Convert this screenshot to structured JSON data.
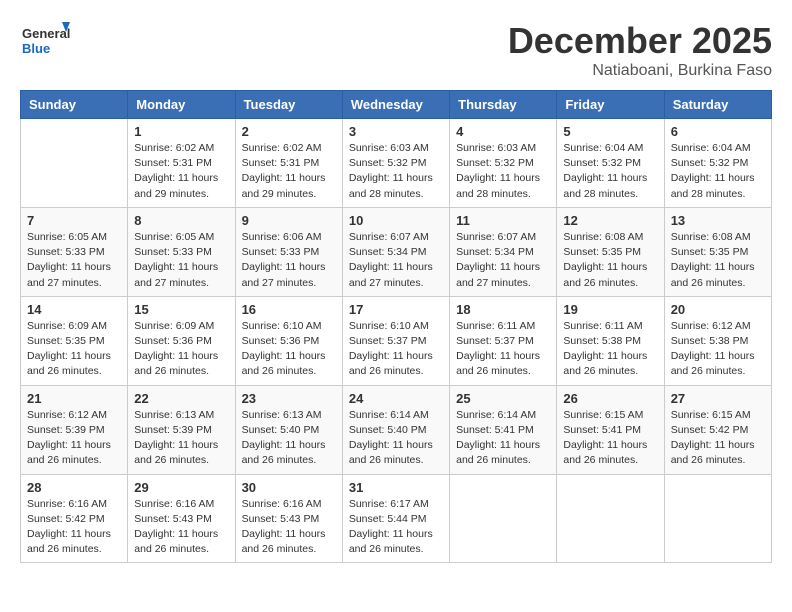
{
  "header": {
    "logo_general": "General",
    "logo_blue": "Blue",
    "month": "December 2025",
    "location": "Natiaboani, Burkina Faso"
  },
  "days_of_week": [
    "Sunday",
    "Monday",
    "Tuesday",
    "Wednesday",
    "Thursday",
    "Friday",
    "Saturday"
  ],
  "weeks": [
    [
      {
        "day": "",
        "sunrise": "",
        "sunset": "",
        "daylight": ""
      },
      {
        "day": "1",
        "sunrise": "Sunrise: 6:02 AM",
        "sunset": "Sunset: 5:31 PM",
        "daylight": "Daylight: 11 hours and 29 minutes."
      },
      {
        "day": "2",
        "sunrise": "Sunrise: 6:02 AM",
        "sunset": "Sunset: 5:31 PM",
        "daylight": "Daylight: 11 hours and 29 minutes."
      },
      {
        "day": "3",
        "sunrise": "Sunrise: 6:03 AM",
        "sunset": "Sunset: 5:32 PM",
        "daylight": "Daylight: 11 hours and 28 minutes."
      },
      {
        "day": "4",
        "sunrise": "Sunrise: 6:03 AM",
        "sunset": "Sunset: 5:32 PM",
        "daylight": "Daylight: 11 hours and 28 minutes."
      },
      {
        "day": "5",
        "sunrise": "Sunrise: 6:04 AM",
        "sunset": "Sunset: 5:32 PM",
        "daylight": "Daylight: 11 hours and 28 minutes."
      },
      {
        "day": "6",
        "sunrise": "Sunrise: 6:04 AM",
        "sunset": "Sunset: 5:32 PM",
        "daylight": "Daylight: 11 hours and 28 minutes."
      }
    ],
    [
      {
        "day": "7",
        "sunrise": "Sunrise: 6:05 AM",
        "sunset": "Sunset: 5:33 PM",
        "daylight": "Daylight: 11 hours and 27 minutes."
      },
      {
        "day": "8",
        "sunrise": "Sunrise: 6:05 AM",
        "sunset": "Sunset: 5:33 PM",
        "daylight": "Daylight: 11 hours and 27 minutes."
      },
      {
        "day": "9",
        "sunrise": "Sunrise: 6:06 AM",
        "sunset": "Sunset: 5:33 PM",
        "daylight": "Daylight: 11 hours and 27 minutes."
      },
      {
        "day": "10",
        "sunrise": "Sunrise: 6:07 AM",
        "sunset": "Sunset: 5:34 PM",
        "daylight": "Daylight: 11 hours and 27 minutes."
      },
      {
        "day": "11",
        "sunrise": "Sunrise: 6:07 AM",
        "sunset": "Sunset: 5:34 PM",
        "daylight": "Daylight: 11 hours and 27 minutes."
      },
      {
        "day": "12",
        "sunrise": "Sunrise: 6:08 AM",
        "sunset": "Sunset: 5:35 PM",
        "daylight": "Daylight: 11 hours and 26 minutes."
      },
      {
        "day": "13",
        "sunrise": "Sunrise: 6:08 AM",
        "sunset": "Sunset: 5:35 PM",
        "daylight": "Daylight: 11 hours and 26 minutes."
      }
    ],
    [
      {
        "day": "14",
        "sunrise": "Sunrise: 6:09 AM",
        "sunset": "Sunset: 5:35 PM",
        "daylight": "Daylight: 11 hours and 26 minutes."
      },
      {
        "day": "15",
        "sunrise": "Sunrise: 6:09 AM",
        "sunset": "Sunset: 5:36 PM",
        "daylight": "Daylight: 11 hours and 26 minutes."
      },
      {
        "day": "16",
        "sunrise": "Sunrise: 6:10 AM",
        "sunset": "Sunset: 5:36 PM",
        "daylight": "Daylight: 11 hours and 26 minutes."
      },
      {
        "day": "17",
        "sunrise": "Sunrise: 6:10 AM",
        "sunset": "Sunset: 5:37 PM",
        "daylight": "Daylight: 11 hours and 26 minutes."
      },
      {
        "day": "18",
        "sunrise": "Sunrise: 6:11 AM",
        "sunset": "Sunset: 5:37 PM",
        "daylight": "Daylight: 11 hours and 26 minutes."
      },
      {
        "day": "19",
        "sunrise": "Sunrise: 6:11 AM",
        "sunset": "Sunset: 5:38 PM",
        "daylight": "Daylight: 11 hours and 26 minutes."
      },
      {
        "day": "20",
        "sunrise": "Sunrise: 6:12 AM",
        "sunset": "Sunset: 5:38 PM",
        "daylight": "Daylight: 11 hours and 26 minutes."
      }
    ],
    [
      {
        "day": "21",
        "sunrise": "Sunrise: 6:12 AM",
        "sunset": "Sunset: 5:39 PM",
        "daylight": "Daylight: 11 hours and 26 minutes."
      },
      {
        "day": "22",
        "sunrise": "Sunrise: 6:13 AM",
        "sunset": "Sunset: 5:39 PM",
        "daylight": "Daylight: 11 hours and 26 minutes."
      },
      {
        "day": "23",
        "sunrise": "Sunrise: 6:13 AM",
        "sunset": "Sunset: 5:40 PM",
        "daylight": "Daylight: 11 hours and 26 minutes."
      },
      {
        "day": "24",
        "sunrise": "Sunrise: 6:14 AM",
        "sunset": "Sunset: 5:40 PM",
        "daylight": "Daylight: 11 hours and 26 minutes."
      },
      {
        "day": "25",
        "sunrise": "Sunrise: 6:14 AM",
        "sunset": "Sunset: 5:41 PM",
        "daylight": "Daylight: 11 hours and 26 minutes."
      },
      {
        "day": "26",
        "sunrise": "Sunrise: 6:15 AM",
        "sunset": "Sunset: 5:41 PM",
        "daylight": "Daylight: 11 hours and 26 minutes."
      },
      {
        "day": "27",
        "sunrise": "Sunrise: 6:15 AM",
        "sunset": "Sunset: 5:42 PM",
        "daylight": "Daylight: 11 hours and 26 minutes."
      }
    ],
    [
      {
        "day": "28",
        "sunrise": "Sunrise: 6:16 AM",
        "sunset": "Sunset: 5:42 PM",
        "daylight": "Daylight: 11 hours and 26 minutes."
      },
      {
        "day": "29",
        "sunrise": "Sunrise: 6:16 AM",
        "sunset": "Sunset: 5:43 PM",
        "daylight": "Daylight: 11 hours and 26 minutes."
      },
      {
        "day": "30",
        "sunrise": "Sunrise: 6:16 AM",
        "sunset": "Sunset: 5:43 PM",
        "daylight": "Daylight: 11 hours and 26 minutes."
      },
      {
        "day": "31",
        "sunrise": "Sunrise: 6:17 AM",
        "sunset": "Sunset: 5:44 PM",
        "daylight": "Daylight: 11 hours and 26 minutes."
      },
      {
        "day": "",
        "sunrise": "",
        "sunset": "",
        "daylight": ""
      },
      {
        "day": "",
        "sunrise": "",
        "sunset": "",
        "daylight": ""
      },
      {
        "day": "",
        "sunrise": "",
        "sunset": "",
        "daylight": ""
      }
    ]
  ]
}
